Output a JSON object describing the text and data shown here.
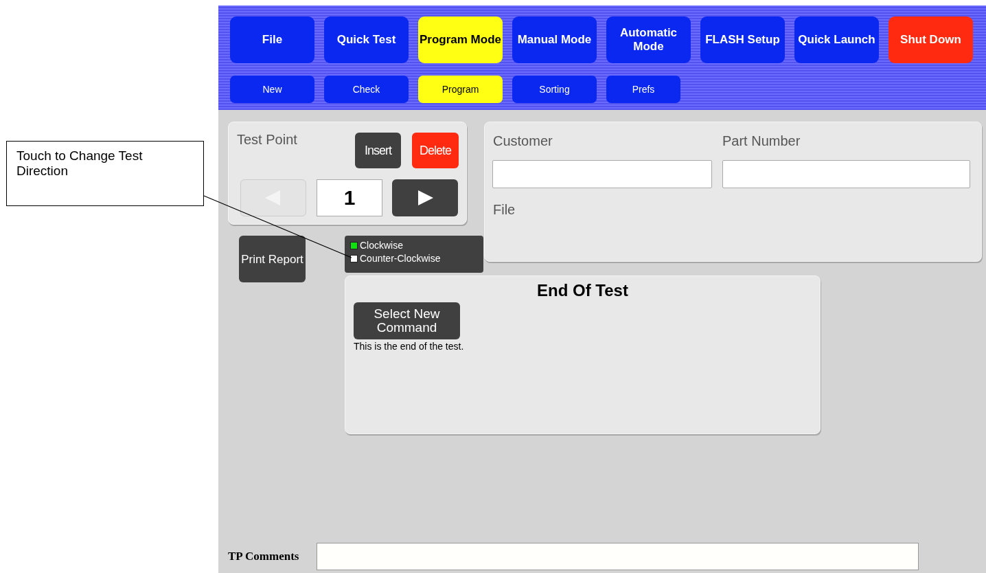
{
  "callout": {
    "text": "Touch to Change Test Direction"
  },
  "main_menu": [
    {
      "label": "File",
      "kind": "normal",
      "selected": false
    },
    {
      "label": "Quick Test",
      "kind": "normal",
      "selected": false
    },
    {
      "label": "Program Mode",
      "kind": "normal",
      "selected": true
    },
    {
      "label": "Manual Mode",
      "kind": "normal",
      "selected": false
    },
    {
      "label": "Automatic Mode",
      "kind": "normal",
      "selected": false
    },
    {
      "label": "FLASH Setup",
      "kind": "normal",
      "selected": false
    },
    {
      "label": "Quick Launch",
      "kind": "normal",
      "selected": false
    },
    {
      "label": "Shut Down",
      "kind": "danger",
      "selected": false
    }
  ],
  "sub_menu": [
    {
      "label": "New",
      "selected": false
    },
    {
      "label": "Check",
      "selected": false
    },
    {
      "label": "Program",
      "selected": true
    },
    {
      "label": "Sorting",
      "selected": false
    },
    {
      "label": "Prefs",
      "selected": false
    }
  ],
  "test_point": {
    "title": "Test Point",
    "insert": "Insert",
    "delete": "Delete",
    "prev": {
      "disabled": true
    },
    "value": "1",
    "next": {
      "disabled": false
    }
  },
  "print_button": "Print Report",
  "direction": [
    {
      "label": "Clockwise",
      "selected": true
    },
    {
      "label": "Counter-Clockwise",
      "selected": false
    }
  ],
  "info": {
    "customer_label": "Customer",
    "part_label": "Part Number",
    "file_label": "File"
  },
  "command": {
    "title": "End Of Test",
    "button": "Select New Command",
    "description": "This is the end of the test."
  },
  "comments": {
    "label": "TP Comments"
  }
}
